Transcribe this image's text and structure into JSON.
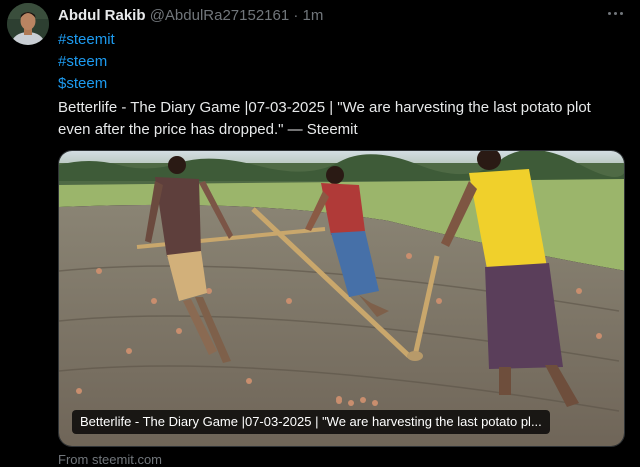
{
  "author": {
    "name": "Abdul Rakib",
    "handle": "@AbdulRa27152161",
    "separator": "·",
    "time": "1m"
  },
  "tweet": {
    "hashtags": [
      "#steemit",
      "#steem",
      "$steem"
    ],
    "text": "Betterlife - The Diary Game |07-03-2025 | \"We are harvesting the last potato plot even after the price has dropped.\" — Steemit"
  },
  "card": {
    "caption": "Betterlife - The Diary Game |07-03-2025 | \"We are harvesting the last potato pl...",
    "source": "From steemit.com"
  },
  "colors": {
    "link": "#1d9bf0",
    "muted": "#71767b",
    "text": "#e7e9ea",
    "background": "#000000"
  },
  "icons": {
    "more": "more-dots-icon"
  }
}
